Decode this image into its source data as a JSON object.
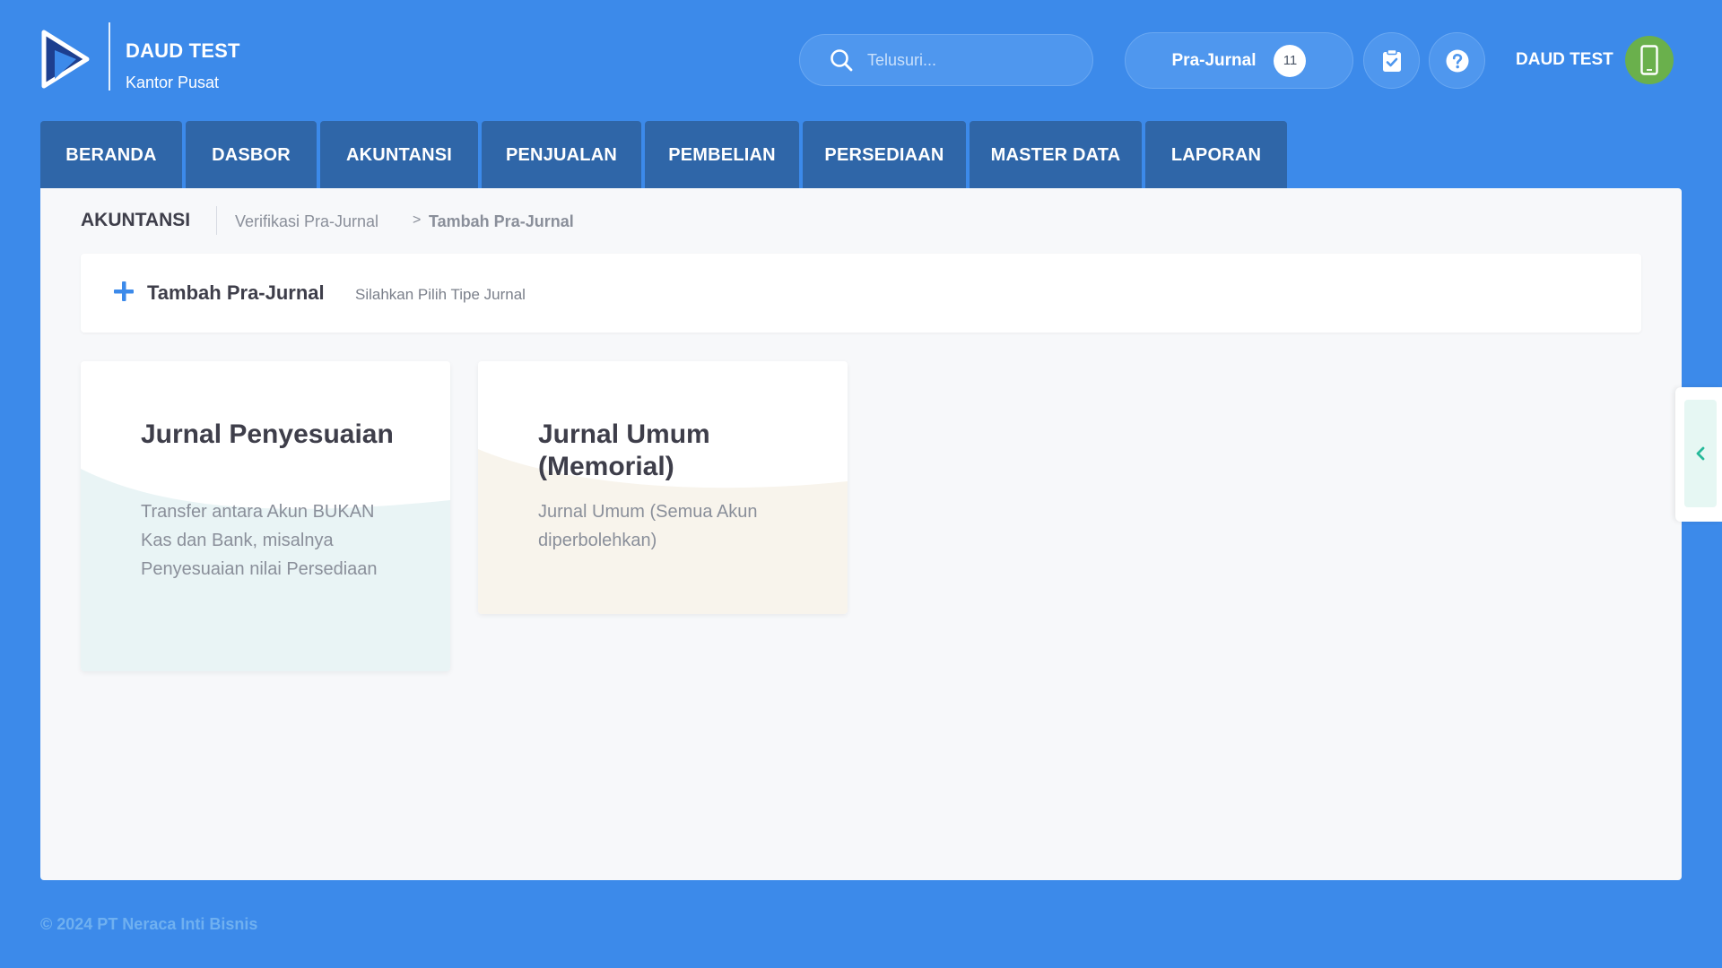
{
  "header": {
    "company_name": "DAUD TEST",
    "branch": "Kantor Pusat",
    "search_placeholder": "Telusuri...",
    "pra_jurnal_label": "Pra-Jurnal",
    "pra_jurnal_count": "11",
    "user_name": "DAUD TEST",
    "icons": [
      "logo-icon",
      "search-icon",
      "clipboard-check-icon",
      "help-icon",
      "phone-icon"
    ]
  },
  "tabs": [
    "BERANDA",
    "DASBOR",
    "AKUNTANSI",
    "PENJUALAN",
    "PEMBELIAN",
    "PERSEDIAAN",
    "MASTER DATA",
    "LAPORAN"
  ],
  "breadcrumb": {
    "section": "AKUNTANSI",
    "parent": "Verifikasi Pra-Jurnal",
    "separator": ">",
    "current": "Tambah Pra-Jurnal"
  },
  "subheader": {
    "title": "Tambah Pra-Jurnal",
    "hint": "Silahkan Pilih Tipe Jurnal"
  },
  "cards": [
    {
      "title": "Jurnal Penyesuaian",
      "description": "Transfer antara Akun BUKAN Kas dan Bank, misalnya Penyesuaian nilai Persediaan",
      "wave_color": "#e9f4f5"
    },
    {
      "title": "Jurnal Umum (Memorial)",
      "description": "Jurnal Umum (Semua Akun diperbolehkan)",
      "wave_color": "#f8f4ec"
    }
  ],
  "footer": "© 2024 PT Neraca Inti Bisnis",
  "colors": {
    "background": "#3c8aea",
    "tab": "#2f66a8",
    "panel": "#f7f8fa",
    "accent_teal": "#26b99a",
    "avatar": "#6ab04c"
  }
}
